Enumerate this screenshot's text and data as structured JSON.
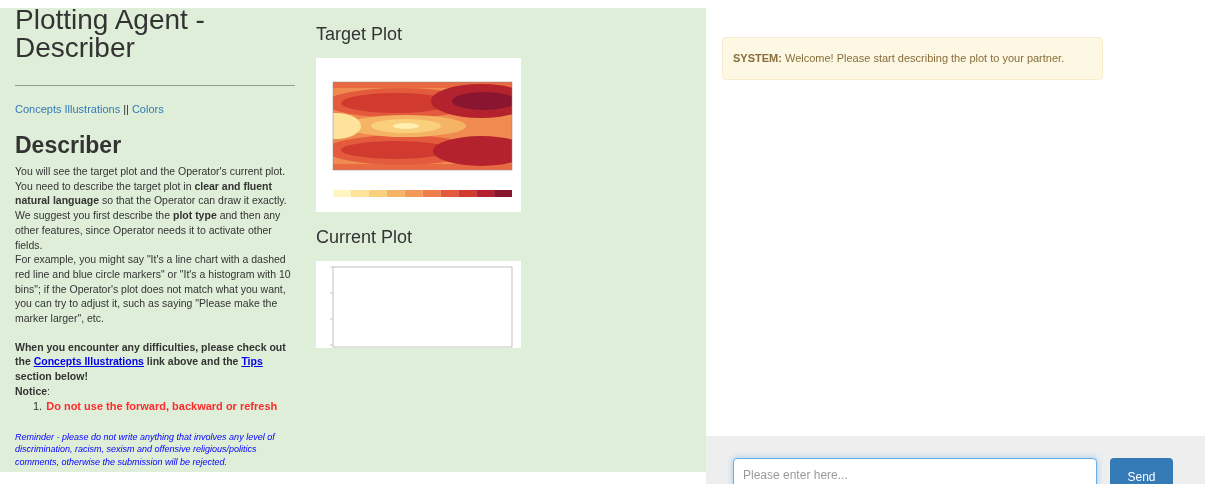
{
  "instructions": {
    "title": "Plotting Agent - Describer",
    "links": [
      {
        "text": "Concepts Illustrations"
      },
      {
        "text": "Colors"
      }
    ],
    "link_separator": "||",
    "heading": "Describer",
    "intro": "You will see the target plot and the Operator's current plot. You need to describe the target plot in **clear and fluent natural language** so that the Operator can draw it exactly. We suggest you first describe the **plot type** and then any other features, since Operator needs it to activate other fields.",
    "example": "For example, you might say \"It's a line chart with a dashed red line and blue circle markers\" or \"It's a histogram with 10 bins\"; if the Operator's plot does not match what you want, you can try to adjust it, such as saying \"Please make the marker larger\", etc.",
    "help": [
      {
        "kind": "text",
        "text": "When you encounter any difficulties, please check out the "
      },
      {
        "kind": "link",
        "text": "Concepts Illustrations"
      },
      {
        "kind": "text",
        "text": " link above and the "
      },
      {
        "kind": "link",
        "text": "Tips"
      },
      {
        "kind": "text",
        "text": " section below!"
      }
    ],
    "notice_label": "**Notice**:",
    "notice_items": [
      {
        "number": "1.",
        "text": "Do not use the forward, backward or refresh"
      }
    ],
    "reminder": "Reminder - please do not write anything that involves any level of discrimination, racism, sexism and offensive religious/politics comments, otherwise the submission will be rejected."
  },
  "plots": [
    {
      "title": "Target Plot",
      "kind": "contour"
    },
    {
      "title": "Current Plot",
      "kind": "empty"
    }
  ],
  "chat": {
    "messages": [
      {
        "sender": "SYSTEM:",
        "text": "Welcome! Please start describing the plot to your partner."
      }
    ],
    "input": {
      "placeholder": "Please enter here..."
    },
    "send_button": "Send"
  }
}
